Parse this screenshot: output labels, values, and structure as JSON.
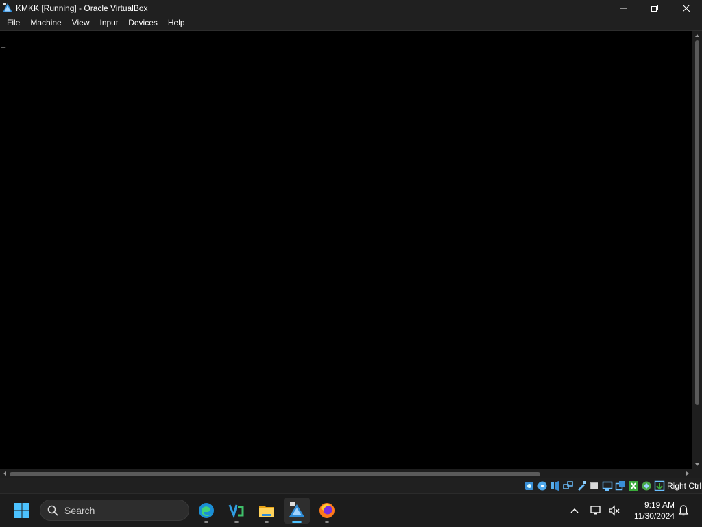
{
  "window": {
    "title": "KMKK [Running] - Oracle VirtualBox",
    "icon": "virtualbox-icon",
    "controls": [
      "minimize-icon",
      "maximize-icon",
      "close-icon"
    ]
  },
  "menu": {
    "items": [
      "File",
      "Machine",
      "View",
      "Input",
      "Devices",
      "Help"
    ]
  },
  "vm_screen": {
    "cursor": "_",
    "background": "#000000"
  },
  "statusbar": {
    "icons": [
      "hard-disk-icon",
      "optical-drive-icon",
      "audio-icon",
      "network-icon",
      "usb-icon",
      "shared-folders-icon",
      "display-icon",
      "video-capture-icon",
      "guest-additions-icon",
      "cpu-icon",
      "mouse-integration-icon",
      "keyboard-capture-icon"
    ],
    "host_key": "Right Ctrl"
  },
  "taskbar": {
    "search_placeholder": "Search",
    "apps": [
      "edge-icon",
      "visual-studio-icon",
      "file-explorer-icon",
      "virtualbox-icon",
      "firefox-icon"
    ],
    "clock": {
      "time": "9:19 AM",
      "date": "11/30/2024"
    }
  },
  "colors": {
    "titlebar": "#202020",
    "taskbar": "#1c1c1c",
    "accent": "#4cc2ff"
  }
}
